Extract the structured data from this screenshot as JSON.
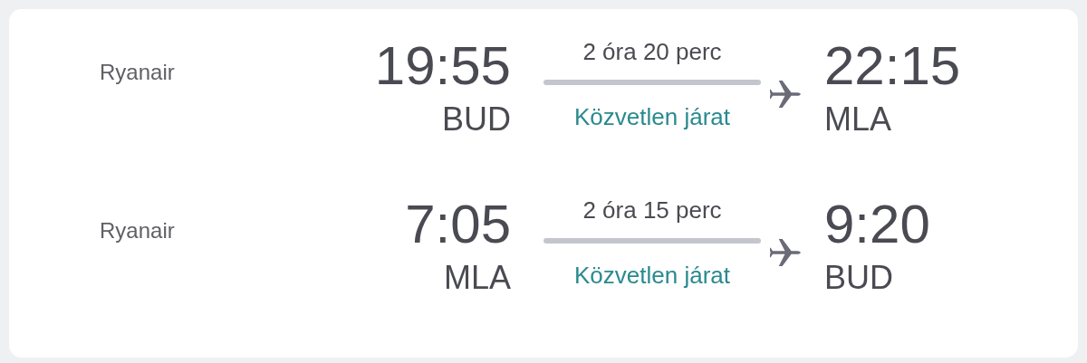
{
  "flights": [
    {
      "airline": "Ryanair",
      "departure_time": "19:55",
      "departure_airport": "BUD",
      "duration": "2 óra 20 perc",
      "stops": "Közvetlen járat",
      "arrival_time": "22:15",
      "arrival_airport": "MLA"
    },
    {
      "airline": "Ryanair",
      "departure_time": "7:05",
      "departure_airport": "MLA",
      "duration": "2 óra 15 perc",
      "stops": "Közvetlen járat",
      "arrival_time": "9:20",
      "arrival_airport": "BUD"
    }
  ]
}
